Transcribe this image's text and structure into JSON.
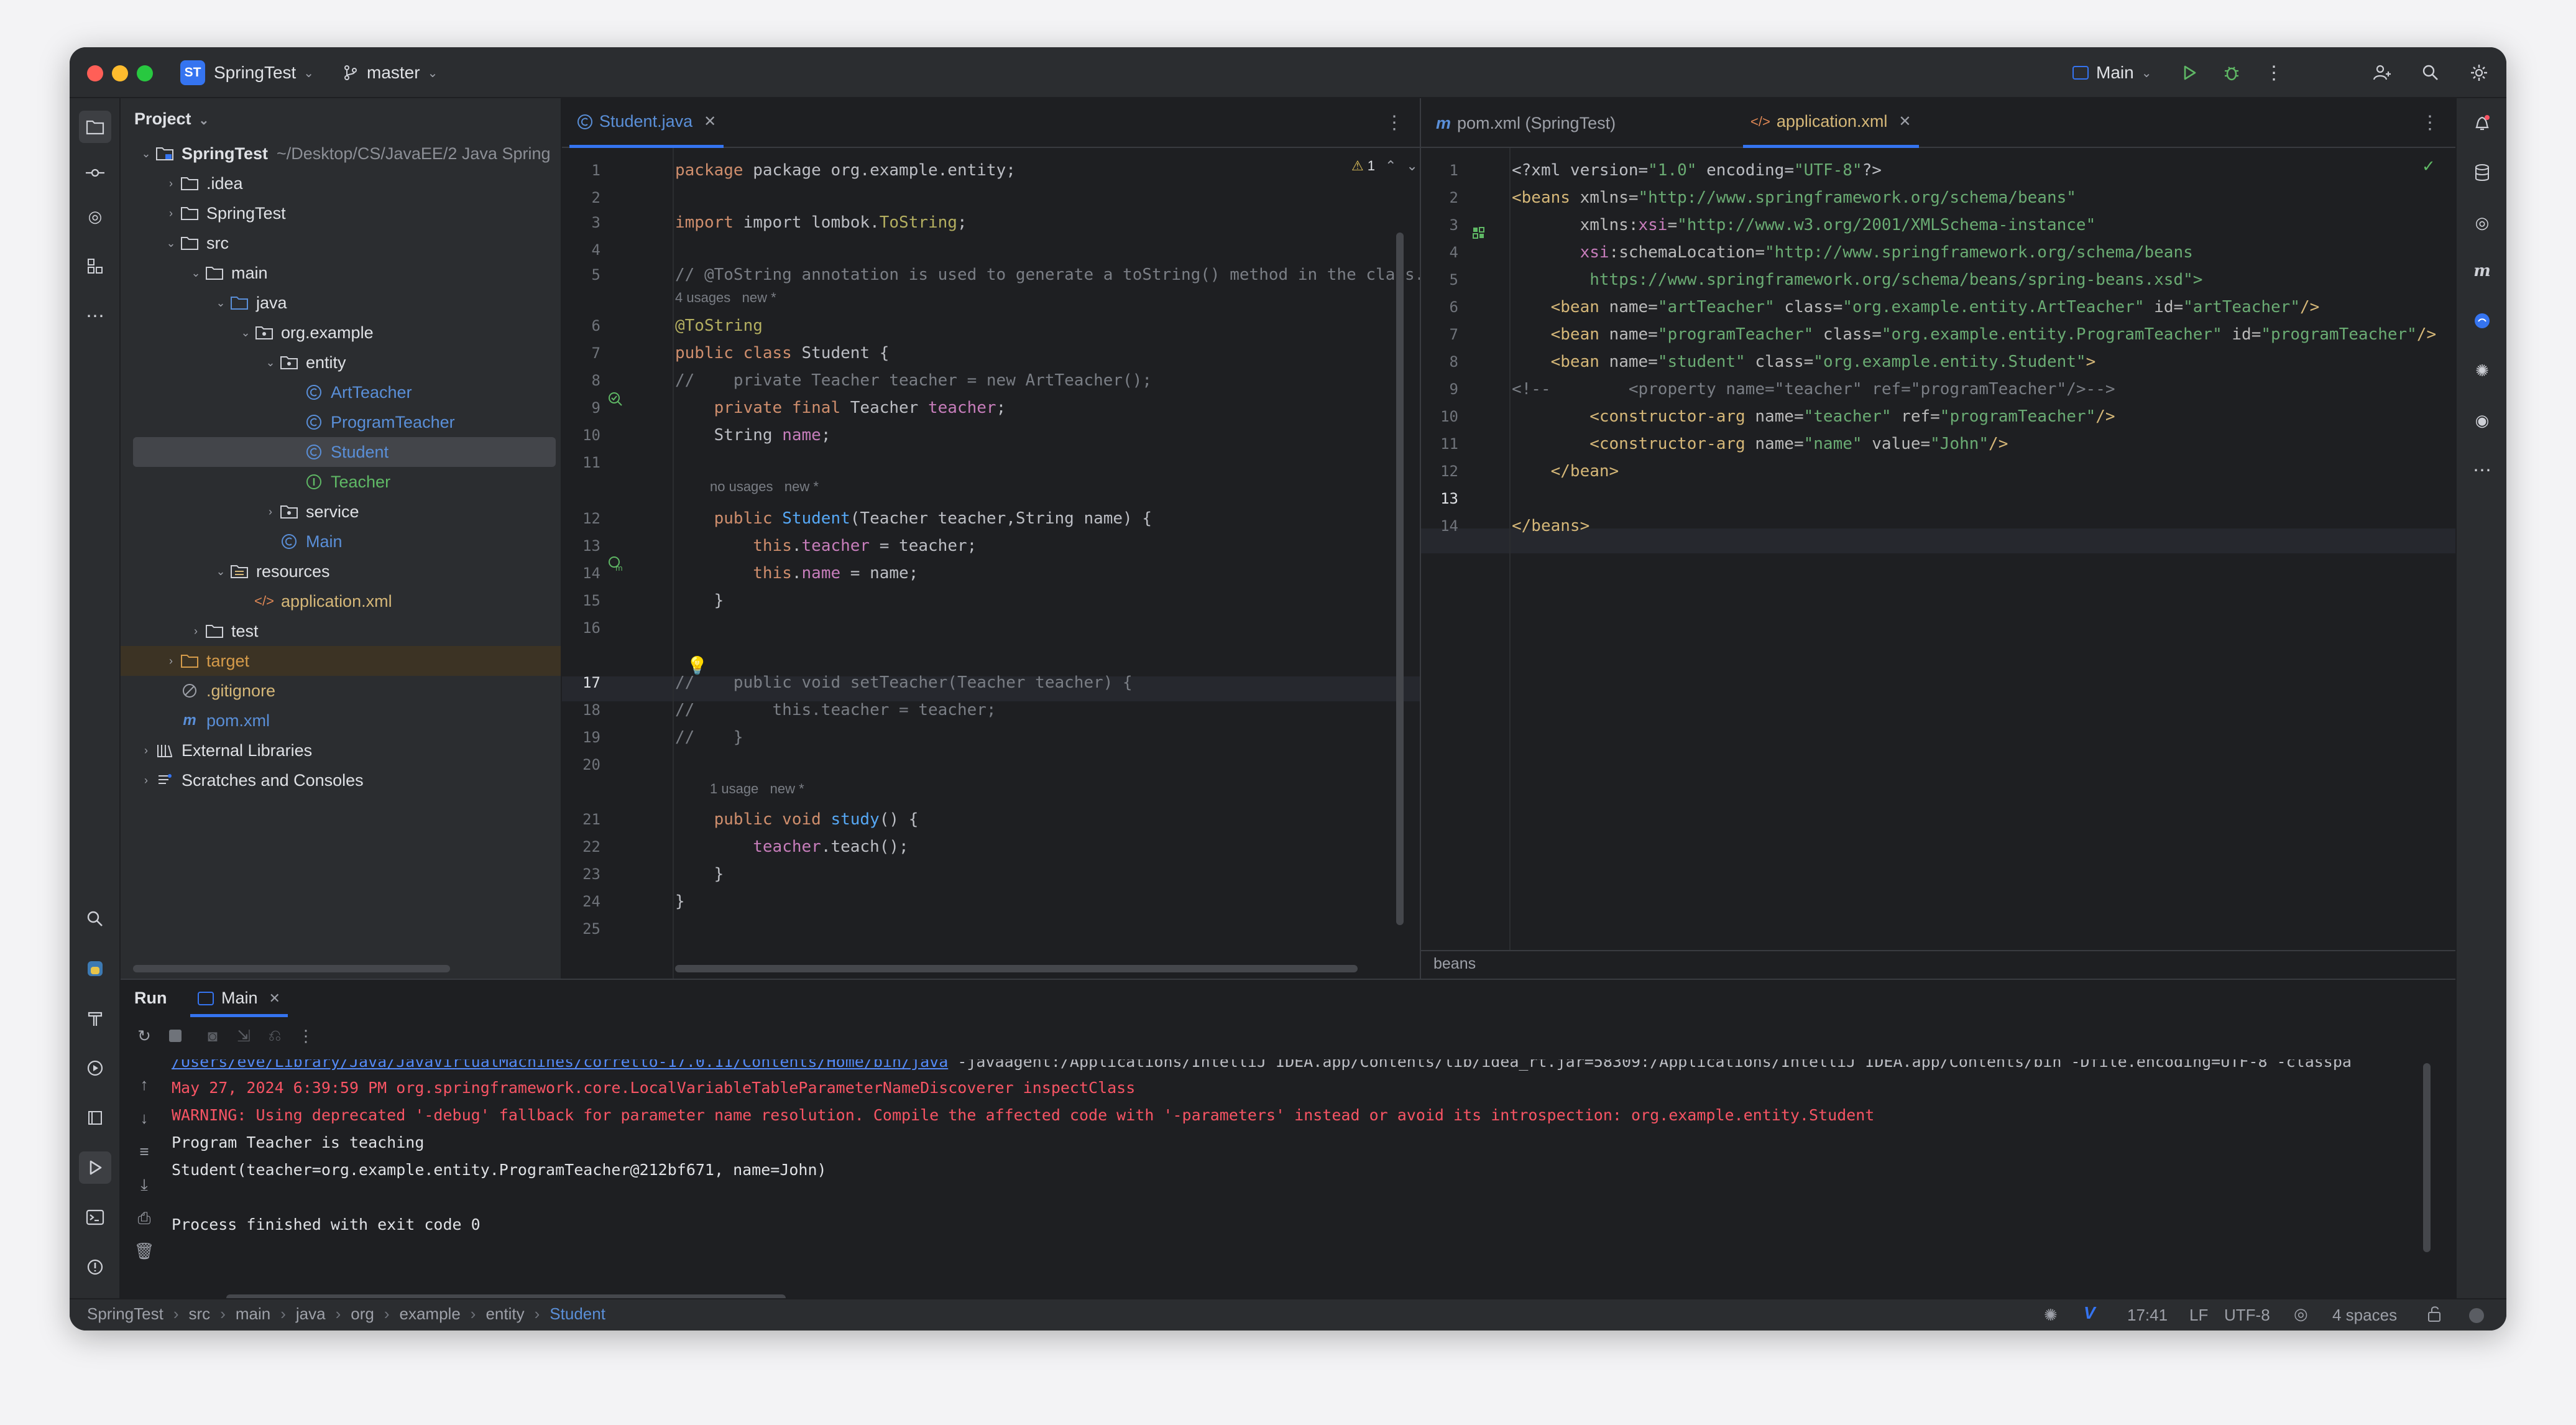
{
  "titlebar": {
    "project_badge": "ST",
    "project_name": "SpringTest",
    "branch": "master",
    "run_config": "Main"
  },
  "project_panel": {
    "title": "Project",
    "root_name": "SpringTest",
    "root_path": "~/Desktop/CS/JavaEE/2 Java Spring",
    "nodes": [
      ".idea",
      "SpringTest",
      "src",
      "main",
      "java",
      "org.example",
      "entity",
      "ArtTeacher",
      "ProgramTeacher",
      "Student",
      "Teacher",
      "service",
      "Main",
      "resources",
      "application.xml",
      "test",
      "target",
      ".gitignore",
      "pom.xml",
      "External Libraries",
      "Scratches and Consoles"
    ]
  },
  "editor_left": {
    "tab": "Student.java",
    "warning_count": "1",
    "gutter": [
      "1",
      "2",
      "3",
      "4",
      "5",
      "6",
      "7",
      "8",
      "9",
      "10",
      "11",
      "12",
      "13",
      "14",
      "15",
      "16",
      "17",
      "18",
      "19",
      "20",
      "21",
      "22",
      "23",
      "24",
      "25"
    ],
    "hints": {
      "usages4": "4 usages   new *",
      "nousages": "no usages   new *",
      "usage1": "1 usage   new *"
    },
    "lines": {
      "l1": "package org.example.entity;",
      "l3a": "import lombok.",
      "l3b": "ToString",
      "l3c": ";",
      "l5": "// @ToString annotation is used to generate a toString() method in the class.",
      "l6": "@ToString",
      "l7a": "public class ",
      "l7b": "Student {",
      "l8": "//    private Teacher teacher = new ArtTeacher();",
      "l9a": "    private final ",
      "l9b": "Teacher ",
      "l9c": "teacher",
      "l9d": ";",
      "l10a": "    String ",
      "l10b": "name",
      "l10c": ";",
      "l12a": "    public ",
      "l12b": "Student",
      "l12c": "(Teacher teacher,String name) {",
      "l13a": "        ",
      "l13b": "this",
      "l13c": ".",
      "l13d": "teacher",
      "l13e": " = teacher;",
      "l14a": "        ",
      "l14b": "this",
      "l14c": ".",
      "l14d": "name",
      "l14e": " = name;",
      "l15": "    }",
      "l17": "//    public void setTeacher(Teacher teacher) {",
      "l18": "//        this.teacher = teacher;",
      "l19": "//    }",
      "l21a": "    public void ",
      "l21b": "study",
      "l21c": "() {",
      "l22a": "        ",
      "l22b": "teacher",
      "l22c": ".teach();",
      "l23": "    }",
      "l24": "}"
    }
  },
  "editor_right": {
    "tab_inactive": "pom.xml (SpringTest)",
    "tab_active": "application.xml",
    "gutter": [
      "1",
      "2",
      "3",
      "4",
      "5",
      "6",
      "7",
      "8",
      "9",
      "10",
      "11",
      "12",
      "13",
      "14"
    ],
    "breadcrumb": "beans",
    "lines": {
      "x1a": "<?xml version=",
      "x1b": "\"1.0\"",
      "x1c": " encoding=",
      "x1d": "\"UTF-8\"",
      "x1e": "?>",
      "x2a": "<beans ",
      "x2b": "xmlns=",
      "x2c": "\"http://www.springframework.org/schema/beans\"",
      "x3a": "       xmlns:",
      "x3b": "xsi",
      "x3c": "=",
      "x3d": "\"http://www.w3.org/2001/XMLSchema-instance\"",
      "x4a": "       ",
      "x4b": "xsi",
      "x4c": ":schemaLocation=",
      "x4d": "\"http://www.springframework.org/schema/beans",
      "x5": "        https://www.springframework.org/schema/beans/spring-beans.xsd\">",
      "x6a": "    <bean ",
      "x6b": "name=",
      "x6c": "\"artTeacher\"",
      "x6d": " class=",
      "x6e": "\"org.example.entity.ArtTeacher\"",
      "x6f": " id=",
      "x6g": "\"artTeacher\"",
      "x6h": "/>",
      "x7a": "    <bean ",
      "x7b": "name=",
      "x7c": "\"programTeacher\"",
      "x7d": " class=",
      "x7e": "\"org.example.entity.ProgramTeacher\"",
      "x7f": " id=",
      "x7g": "\"programTeacher\"",
      "x7h": "/>",
      "x8a": "    <bean ",
      "x8b": "name=",
      "x8c": "\"student\"",
      "x8d": " class=",
      "x8e": "\"org.example.entity.Student\"",
      "x8f": ">",
      "x9": "<!--        <property name=\"teacher\" ref=\"programTeacher\"/>-->",
      "x10a": "        <constructor-arg ",
      "x10b": "name=",
      "x10c": "\"teacher\"",
      "x10d": " ref=",
      "x10e": "\"programTeacher\"",
      "x10f": "/>",
      "x11a": "        <constructor-arg ",
      "x11b": "name=",
      "x11c": "\"name\"",
      "x11d": " value=",
      "x11e": "\"John\"",
      "x11f": "/>",
      "x12": "    </bean>",
      "x14": "</beans>"
    }
  },
  "run_panel": {
    "title": "Run",
    "tab": "Main",
    "console": {
      "cmd_link": "/Users/eve/Library/Java/JavaVirtualMachines/corretto-17.0.11/Contents/Home/bin/java",
      "cmd_rest": " -javaagent:/Applications/IntelliJ IDEA.app/Contents/lib/idea_rt.jar=58309:/Applications/IntelliJ IDEA.app/Contents/bin -Dfile.encoding=UTF-8 -classpa",
      "log1": "May 27, 2024 6:39:59 PM org.springframework.core.LocalVariableTableParameterNameDiscoverer inspectClass",
      "log2": "WARNING: Using deprecated '-debug' fallback for parameter name resolution. Compile the affected code with '-parameters' instead or avoid its introspection: org.example.entity.Student",
      "out1": "Program Teacher is teaching",
      "out2": "Student(teacher=org.example.entity.ProgramTeacher@212bf671, name=John)",
      "out3": "Process finished with exit code 0"
    }
  },
  "statusbar": {
    "breadcrumbs": [
      "SpringTest",
      "src",
      "main",
      "java",
      "org",
      "example",
      "entity",
      "Student"
    ],
    "position": "17:41",
    "line_sep": "LF",
    "encoding": "UTF-8",
    "indent": "4 spaces"
  },
  "colors": {
    "accent": "#3574f0",
    "editor_bg": "#1e1f22",
    "panel_bg": "#2b2d30",
    "keyword": "#cf8e6d",
    "string": "#6aab73",
    "error": "#f75464"
  }
}
